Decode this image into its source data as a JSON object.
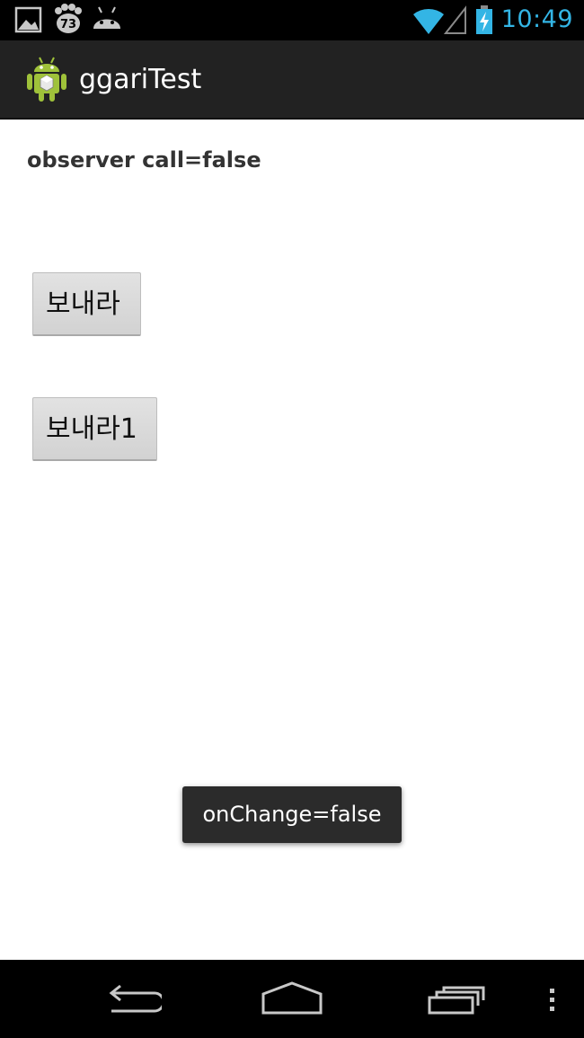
{
  "status_bar": {
    "time": "10:49",
    "notification_badge": "73",
    "icons": [
      "gallery-icon",
      "paw-badge-icon",
      "android-head-icon",
      "wifi-icon",
      "signal-icon",
      "battery-charging-icon"
    ],
    "accent_color": "#33b5e5"
  },
  "action_bar": {
    "title": "ggariTest",
    "icon": "android-app-icon"
  },
  "content": {
    "observer_text": "observer call=false",
    "button_send_label": "보내라",
    "button_send1_label": "보내라1"
  },
  "toast": {
    "message": "onChange=false"
  },
  "nav_bar": {
    "icons": [
      "back-icon",
      "home-icon",
      "recent-apps-icon",
      "overflow-menu-icon"
    ]
  }
}
